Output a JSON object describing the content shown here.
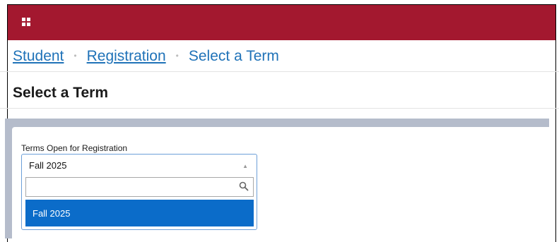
{
  "colors": {
    "brand": "#a3182f",
    "link": "#1f72b8",
    "highlight": "#0b6cc9",
    "panel_bg": "#b5bccb"
  },
  "header": {
    "menu_icon": "grid-icon"
  },
  "breadcrumb": {
    "items": [
      {
        "label": "Student"
      },
      {
        "label": "Registration"
      },
      {
        "label": "Select a Term"
      }
    ],
    "separator": "•"
  },
  "page": {
    "title": "Select a Term"
  },
  "term_select": {
    "label": "Terms Open for Registration",
    "selected": "Fall 2025",
    "arrow": "▲",
    "search_value": "",
    "search_icon": "search-icon",
    "options": [
      {
        "label": "Fall 2025",
        "highlighted": true
      }
    ]
  }
}
